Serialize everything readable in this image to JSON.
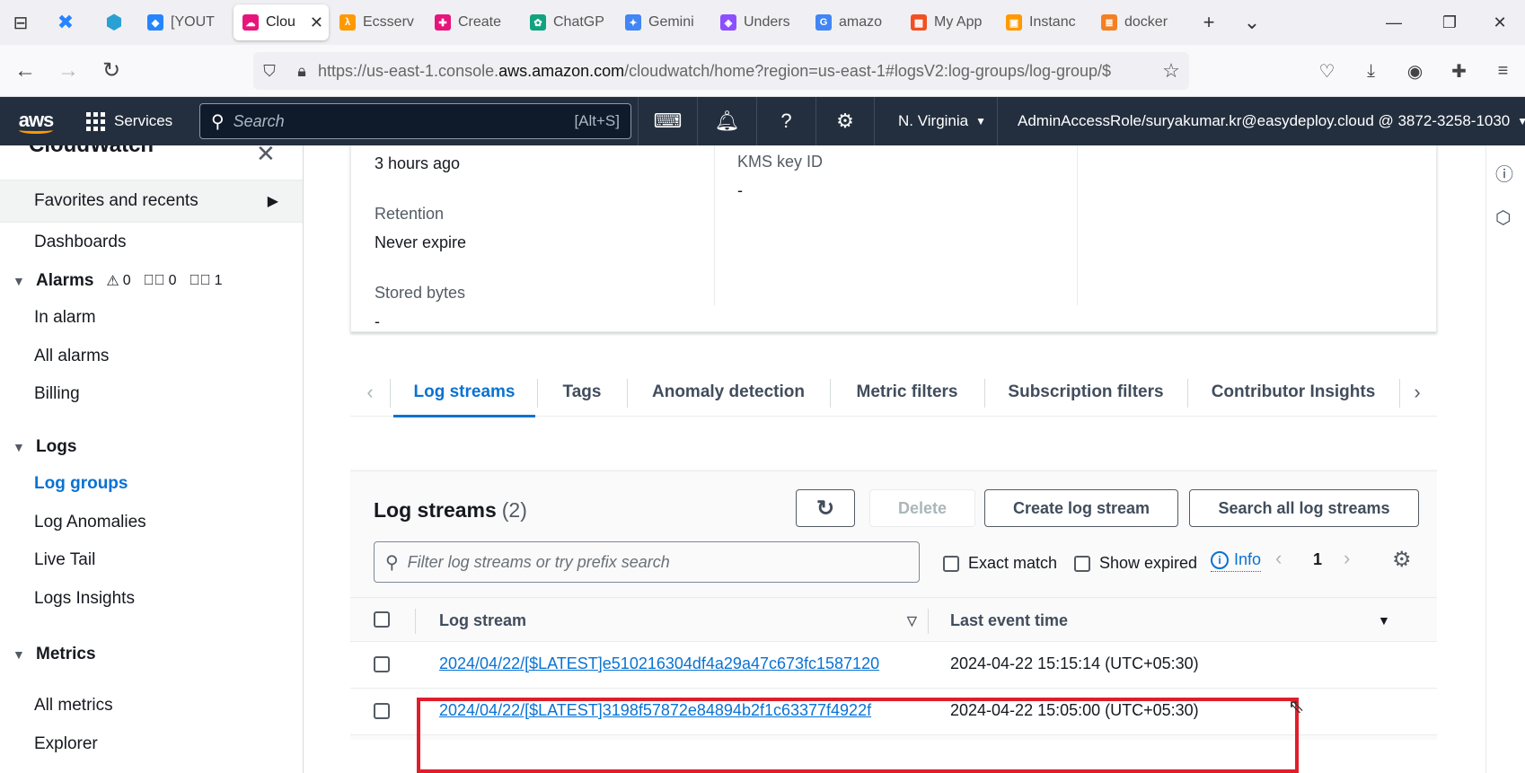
{
  "browser": {
    "tabs": [
      {
        "label": "[YOUT",
        "color": "#2684ff",
        "glyph": "◆"
      },
      {
        "label": "Clou",
        "color": "#e7157b",
        "glyph": "☁",
        "active": true
      },
      {
        "label": "Ecsserv",
        "color": "#ff9900",
        "glyph": "λ"
      },
      {
        "label": "Create",
        "color": "#e7157b",
        "glyph": "✚"
      },
      {
        "label": "ChatGP",
        "color": "#10a37f",
        "glyph": "✿"
      },
      {
        "label": "Gemini",
        "color": "#4285f4",
        "glyph": "✦"
      },
      {
        "label": "Unders",
        "color": "#8c4fff",
        "glyph": "◈"
      },
      {
        "label": "amazo",
        "color": "#4285f4",
        "glyph": "G"
      },
      {
        "label": "My App",
        "color": "#f25022",
        "glyph": "▦"
      },
      {
        "label": "Instanc",
        "color": "#ff9900",
        "glyph": "▣"
      },
      {
        "label": "docker",
        "color": "#f48024",
        "glyph": "≣"
      }
    ],
    "url_prefix": "https://us-east-1.console.",
    "url_domain": "aws.amazon.com",
    "url_suffix": "/cloudwatch/home?region=us-east-1#logsV2:log-groups/log-group/$"
  },
  "aws_header": {
    "logo": "aws",
    "services_label": "Services",
    "search_placeholder": "Search",
    "search_shortcut": "[Alt+S]",
    "region": "N. Virginia",
    "account": "AdminAccessRole/suryakumar.kr@easydeploy.cloud @ 3872-3258-1030"
  },
  "sidebar": {
    "title": "CloudWatch",
    "favorites": "Favorites and recents",
    "dashboards": "Dashboards",
    "alarms": {
      "label": "Alarms",
      "warn": "0",
      "ok": "0",
      "insufficient": "1"
    },
    "alarm_items": [
      "In alarm",
      "All alarms",
      "Billing"
    ],
    "logs": "Logs",
    "log_items": [
      "Log groups",
      "Log Anomalies",
      "Live Tail",
      "Logs Insights"
    ],
    "metrics": "Metrics",
    "metric_items": [
      "All metrics",
      "Explorer"
    ]
  },
  "details": {
    "created_value": "3 hours ago",
    "retention_label": "Retention",
    "retention_value": "Never expire",
    "stored_label": "Stored bytes",
    "stored_value": "-",
    "kms_label": "KMS key ID",
    "kms_value": "-"
  },
  "tabs": [
    "Log streams",
    "Tags",
    "Anomaly detection",
    "Metric filters",
    "Subscription filters",
    "Contributor Insights"
  ],
  "log_streams": {
    "title": "Log streams",
    "count": "(2)",
    "delete_label": "Delete",
    "create_label": "Create log stream",
    "search_all_label": "Search all log streams",
    "filter_placeholder": "Filter log streams or try prefix search",
    "exact_match": "Exact match",
    "show_expired": "Show expired",
    "info": "Info",
    "page": "1",
    "col_stream": "Log stream",
    "col_time": "Last event time",
    "rows": [
      {
        "name": "2024/04/22/[$LATEST]e510216304df4a29a47c673fc1587120",
        "time": "2024-04-22 15:15:14 (UTC+05:30)"
      },
      {
        "name": "2024/04/22/[$LATEST]3198f57872e84894b2f1c63377f4922f",
        "time": "2024-04-22 15:05:00 (UTC+05:30)"
      }
    ]
  },
  "colors": {
    "aws_nav": "#232f3e",
    "link": "#0972d3",
    "highlight": "#e11d2b"
  }
}
